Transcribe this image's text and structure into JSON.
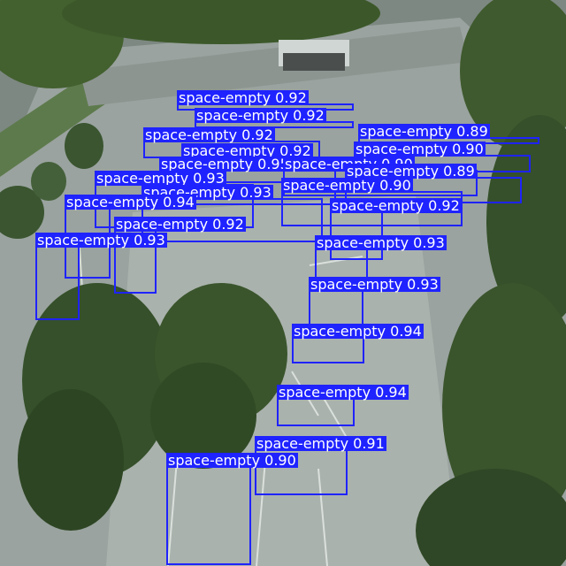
{
  "detections": [
    {
      "class": "space-empty",
      "score": "0.92"
    },
    {
      "class": "space-empty",
      "score": "0.92"
    },
    {
      "class": "space-empty",
      "score": "0.89"
    },
    {
      "class": "space-empty",
      "score": "0.92"
    },
    {
      "class": "space-empty",
      "score": "0.90"
    },
    {
      "class": "space-empty",
      "score": "0.92"
    },
    {
      "class": "space-empty",
      "score": "0.95"
    },
    {
      "class": "space-empty",
      "score": "0.90"
    },
    {
      "class": "space-empty",
      "score": "0.89"
    },
    {
      "class": "space-empty",
      "score": "0.93"
    },
    {
      "class": "space-empty",
      "score": "0.93"
    },
    {
      "class": "space-empty",
      "score": "0.90"
    },
    {
      "class": "space-empty",
      "score": "0.94"
    },
    {
      "class": "space-empty",
      "score": "0.92"
    },
    {
      "class": "space-empty",
      "score": "0.92"
    },
    {
      "class": "space-empty",
      "score": "0.93"
    },
    {
      "class": "space-empty",
      "score": "0.93"
    },
    {
      "class": "space-empty",
      "score": "0.93"
    },
    {
      "class": "space-empty",
      "score": "0.94"
    },
    {
      "class": "space-empty",
      "score": "0.94"
    },
    {
      "class": "space-empty",
      "score": "0.91"
    },
    {
      "class": "space-empty",
      "score": "0.90"
    }
  ]
}
